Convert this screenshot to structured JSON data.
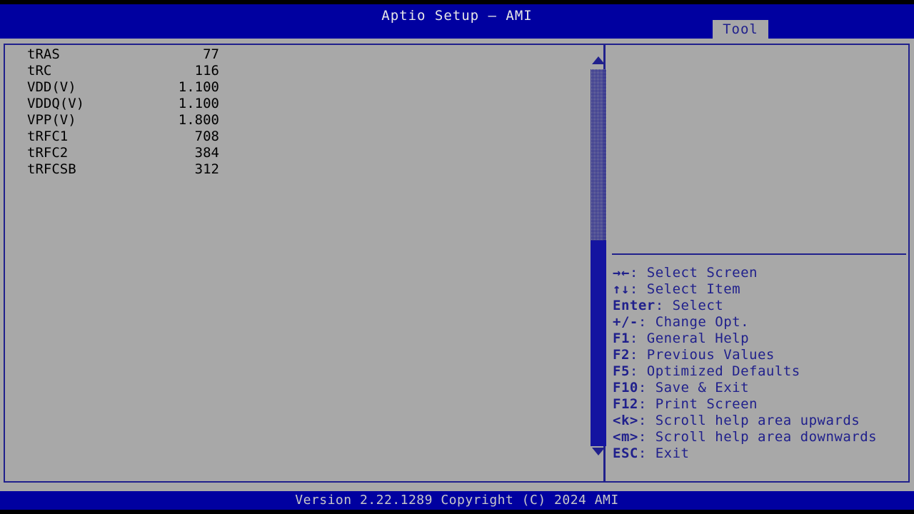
{
  "colors": {
    "title_bar": "#0000A0",
    "panel_bg": "#A8A8A8",
    "border": "#20208C",
    "help_text": "#20208C",
    "list_text": "#000000",
    "footer_text": "#C8C8C8",
    "scrollbar_thumb": "#1414A0"
  },
  "title": {
    "text": "Aptio Setup – AMI"
  },
  "tabs": [
    {
      "label": "Tool",
      "active": true
    }
  ],
  "main": {
    "items": [
      {
        "label": "tRAS",
        "value": "77"
      },
      {
        "label": "tRC",
        "value": "116"
      },
      {
        "label": "VDD(V)",
        "value": "1.100"
      },
      {
        "label": "VDDQ(V)",
        "value": "1.100"
      },
      {
        "label": "VPP(V)",
        "value": "1.800"
      },
      {
        "label": "tRFC1",
        "value": "708"
      },
      {
        "label": "tRFC2",
        "value": "384"
      },
      {
        "label": "tRFCSB",
        "value": "312"
      }
    ]
  },
  "scrollbar": {
    "up_arrow": "triangle-up-icon",
    "down_arrow": "triangle-down-icon"
  },
  "help": {
    "description": "",
    "keys": [
      {
        "key": "→←",
        "text": ": Select Screen"
      },
      {
        "key": "↑↓",
        "text": ": Select Item"
      },
      {
        "key": "Enter",
        "text": ": Select"
      },
      {
        "key": "+/-",
        "text": ": Change Opt."
      },
      {
        "key": "F1",
        "text": ": General Help"
      },
      {
        "key": "F2",
        "text": ": Previous Values"
      },
      {
        "key": "F5",
        "text": ": Optimized Defaults"
      },
      {
        "key": "F10",
        "text": ": Save & Exit"
      },
      {
        "key": "F12",
        "text": ": Print Screen"
      },
      {
        "key": "<k>",
        "text": ": Scroll help area upwards"
      },
      {
        "key": "<m>",
        "text": ": Scroll help area downwards"
      },
      {
        "key": "ESC",
        "text": ": Exit"
      }
    ]
  },
  "footer": {
    "text": "Version 2.22.1289 Copyright (C) 2024 AMI"
  }
}
